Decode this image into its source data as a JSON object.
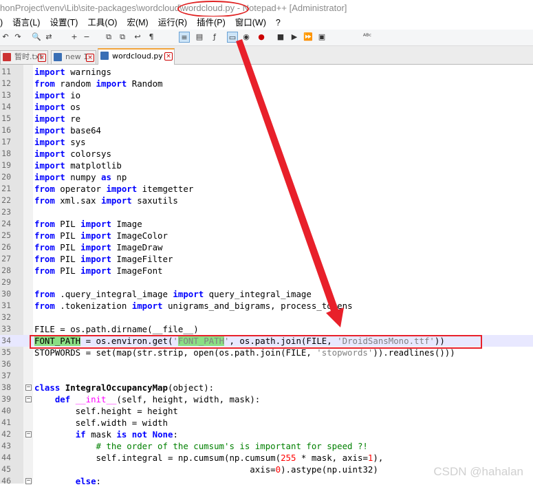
{
  "window": {
    "title": "honProject\\venv\\Lib\\site-packages\\wordcloud\\wordcloud.py - Notepad++ [Administrator]"
  },
  "menu": [
    ")",
    "语言(L)",
    "设置(T)",
    "工具(O)",
    "宏(M)",
    "运行(R)",
    "插件(P)",
    "窗口(W)",
    "?"
  ],
  "tabs": [
    {
      "label": "暂时.txt",
      "color": "#cc3333"
    },
    {
      "label": "new 1",
      "color": "#3a6fb5"
    },
    {
      "label": "wordcloud.py",
      "color": "#3a6fb5",
      "active": true
    }
  ],
  "editor": {
    "current_line": "34",
    "lines": [
      {
        "n": "11",
        "t": "import warnings"
      },
      {
        "n": "12",
        "t": "from random import Random"
      },
      {
        "n": "13",
        "t": "import io"
      },
      {
        "n": "14",
        "t": "import os"
      },
      {
        "n": "15",
        "t": "import re"
      },
      {
        "n": "16",
        "t": "import base64"
      },
      {
        "n": "17",
        "t": "import sys"
      },
      {
        "n": "18",
        "t": "import colorsys"
      },
      {
        "n": "19",
        "t": "import matplotlib"
      },
      {
        "n": "20",
        "t": "import numpy as np"
      },
      {
        "n": "21",
        "t": "from operator import itemgetter"
      },
      {
        "n": "22",
        "t": "from xml.sax import saxutils"
      },
      {
        "n": "23",
        "t": ""
      },
      {
        "n": "24",
        "t": "from PIL import Image"
      },
      {
        "n": "25",
        "t": "from PIL import ImageColor"
      },
      {
        "n": "26",
        "t": "from PIL import ImageDraw"
      },
      {
        "n": "27",
        "t": "from PIL import ImageFilter"
      },
      {
        "n": "28",
        "t": "from PIL import ImageFont"
      },
      {
        "n": "29",
        "t": ""
      },
      {
        "n": "30",
        "t": "from .query_integral_image import query_integral_image"
      },
      {
        "n": "31",
        "t": "from .tokenization import unigrams_and_bigrams, process_tokens"
      },
      {
        "n": "32",
        "t": ""
      },
      {
        "n": "33",
        "t": "FILE = os.path.dirname(__file__)"
      },
      {
        "n": "34",
        "t": "FONT_PATH = os.environ.get('FONT_PATH', os.path.join(FILE, 'DroidSansMono.ttf'))"
      },
      {
        "n": "35",
        "t": "STOPWORDS = set(map(str.strip, open(os.path.join(FILE, 'stopwords')).readlines()))"
      },
      {
        "n": "36",
        "t": ""
      },
      {
        "n": "37",
        "t": ""
      },
      {
        "n": "38",
        "t": "class IntegralOccupancyMap(object):"
      },
      {
        "n": "39",
        "t": "    def __init__(self, height, width, mask):"
      },
      {
        "n": "40",
        "t": "        self.height = height"
      },
      {
        "n": "41",
        "t": "        self.width = width"
      },
      {
        "n": "42",
        "t": "        if mask is not None:"
      },
      {
        "n": "43",
        "t": "            # the order of the cumsum's is important for speed ?!"
      },
      {
        "n": "44",
        "t": "            self.integral = np.cumsum(np.cumsum(255 * mask, axis=1),"
      },
      {
        "n": "45",
        "t": "                                          axis=0).astype(np.uint32)"
      },
      {
        "n": "46",
        "t": "        else:"
      }
    ]
  },
  "watermark": "CSDN @hahalan",
  "colors": {
    "annotation": "#e8202a",
    "keyword": "#0000ff",
    "string": "#808080",
    "number": "#ff0000",
    "comment": "#008000",
    "match_highlight": "#8adf84"
  }
}
